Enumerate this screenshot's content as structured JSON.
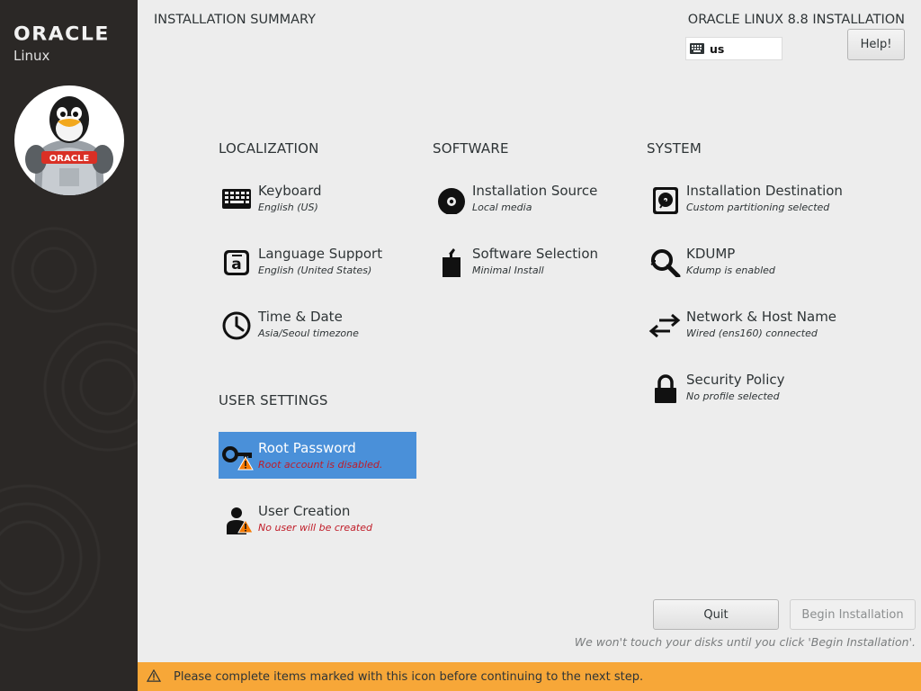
{
  "window": {
    "title": "INSTALLATION SUMMARY",
    "product": "ORACLE LINUX 8.8 INSTALLATION",
    "keyboard_layout": "us",
    "help_label": "Help!"
  },
  "brand": {
    "name": "ORACLE",
    "sub": "Linux",
    "mascot_badge": "ORACLE"
  },
  "sections": {
    "localization": "LOCALIZATION",
    "software": "SOFTWARE",
    "system": "SYSTEM",
    "user_settings": "USER SETTINGS"
  },
  "spokes": {
    "keyboard": {
      "label": "Keyboard",
      "status": "English (US)",
      "icon": "keyboard-icon"
    },
    "language": {
      "label": "Language Support",
      "status": "English (United States)",
      "icon": "language-icon"
    },
    "time": {
      "label": "Time & Date",
      "status": "Asia/Seoul timezone",
      "icon": "clock-icon"
    },
    "source": {
      "label": "Installation Source",
      "status": "Local media",
      "icon": "disc-icon"
    },
    "software": {
      "label": "Software Selection",
      "status": "Minimal Install",
      "icon": "package-icon"
    },
    "destination": {
      "label": "Installation Destination",
      "status": "Custom partitioning selected",
      "icon": "harddisk-icon"
    },
    "kdump": {
      "label": "KDUMP",
      "status": "Kdump is enabled",
      "icon": "magnifier-icon"
    },
    "network": {
      "label": "Network & Host Name",
      "status": "Wired (ens160) connected",
      "icon": "network-arrows-icon"
    },
    "security": {
      "label": "Security Policy",
      "status": "No profile selected",
      "icon": "lock-icon"
    },
    "root": {
      "label": "Root Password",
      "status": "Root account is disabled.",
      "icon": "key-icon"
    },
    "user": {
      "label": "User Creation",
      "status": "No user will be created",
      "icon": "user-icon"
    }
  },
  "footer": {
    "quit_label": "Quit",
    "begin_label": "Begin Installation",
    "disk_note": "We won't touch your disks until you click 'Begin Installation'.",
    "warning_text": "Please complete items marked with this icon before continuing to the next step."
  },
  "colors": {
    "selected": "#4a90d9",
    "warning_bar": "#f7a738",
    "warning_text": "#c01c28",
    "sidebar": "#2b2826"
  }
}
